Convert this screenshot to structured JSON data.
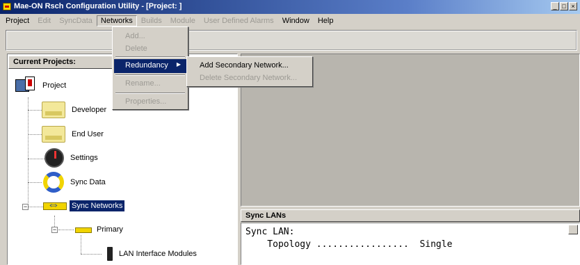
{
  "window": {
    "title": "Mae-ON Rsch Configuration Utility - [Project: ]",
    "controls": [
      "_",
      "□",
      "×"
    ]
  },
  "menu": [
    {
      "label": "Project",
      "disabled": false
    },
    {
      "label": "Edit",
      "disabled": true
    },
    {
      "label": "SyncData",
      "disabled": true
    },
    {
      "label": "Networks",
      "disabled": false,
      "open": true
    },
    {
      "label": "Builds",
      "disabled": true
    },
    {
      "label": "Module",
      "disabled": true
    },
    {
      "label": "User Defined Alarms",
      "disabled": true
    },
    {
      "label": "Window",
      "disabled": false
    },
    {
      "label": "Help",
      "disabled": false
    }
  ],
  "networks_menu": {
    "add": "Add...",
    "delete": "Delete",
    "redundancy": "Redundancy",
    "rename": "Rename...",
    "properties": "Properties..."
  },
  "redundancy_submenu": {
    "add_secondary": "Add Secondary Network...",
    "delete_secondary": "Delete Secondary Network..."
  },
  "projects_panel": {
    "header": "Current Projects:",
    "tree": {
      "project": "Project",
      "developer": "Developer",
      "end_user": "End User",
      "settings": "Settings",
      "sync_data": "Sync Data",
      "sync_networks": "Sync Networks",
      "primary": "Primary",
      "lan_modules": "LAN Interface Modules"
    }
  },
  "sync_lans_panel": {
    "header": "Sync LANs",
    "line1": "Sync LAN:",
    "line2": "    Topology .................  Single"
  }
}
